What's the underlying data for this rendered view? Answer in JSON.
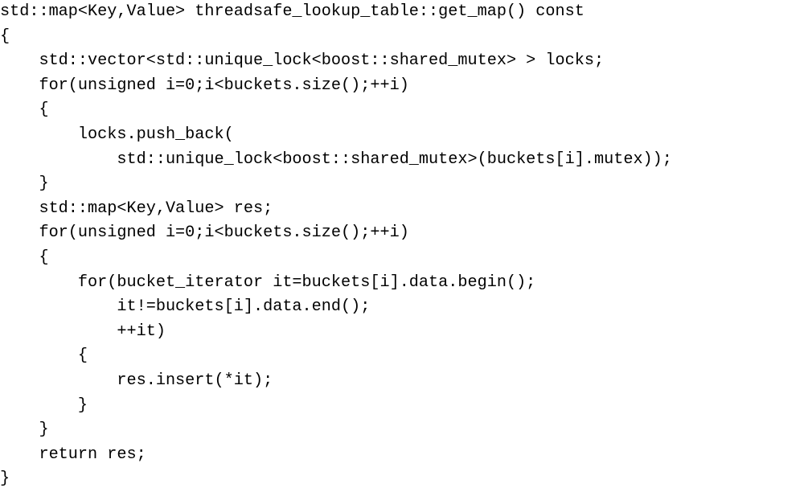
{
  "code": {
    "lines": [
      "std::map<Key,Value> threadsafe_lookup_table::get_map() const",
      "{",
      "    std::vector<std::unique_lock<boost::shared_mutex> > locks;",
      "    for(unsigned i=0;i<buckets.size();++i)",
      "    {",
      "        locks.push_back(",
      "            std::unique_lock<boost::shared_mutex>(buckets[i].mutex));",
      "    }",
      "    std::map<Key,Value> res;",
      "    for(unsigned i=0;i<buckets.size();++i)",
      "    {",
      "        for(bucket_iterator it=buckets[i].data.begin();",
      "            it!=buckets[i].data.end();",
      "            ++it)",
      "        {",
      "            res.insert(*it);",
      "        }",
      "    }",
      "    return res;",
      "}"
    ]
  }
}
